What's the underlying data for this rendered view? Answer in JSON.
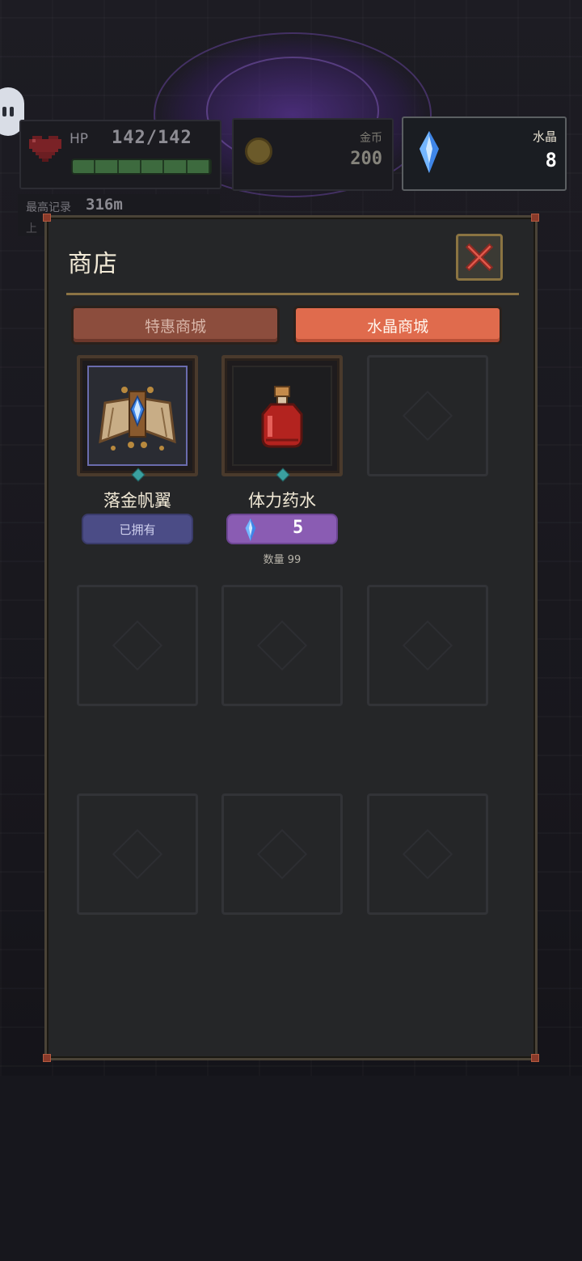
{
  "hud": {
    "hp_label": "HP",
    "hp_value": "142/142",
    "hp_fraction": 1.0,
    "gold_label": "金币",
    "gold_value": "200",
    "crystal_label": "水晶",
    "crystal_value": "8"
  },
  "record": {
    "label": "最高记录",
    "value": "316m",
    "sub": "上"
  },
  "shop": {
    "title": "商店",
    "close_icon": "close-x-icon",
    "tabs": [
      {
        "label": "特惠商城",
        "active": false
      },
      {
        "label": "水晶商城",
        "active": true
      }
    ],
    "items": [
      {
        "name": "落金帆翼",
        "icon": "golden-sail-wings-icon",
        "status": "已拥有"
      },
      {
        "name": "体力药水",
        "icon": "stamina-potion-icon",
        "price": "5",
        "price_icon": "crystal-icon",
        "quantity": "数量 99"
      }
    ]
  },
  "colors": {
    "accent_tab_active": "#e06b4d",
    "tab_inactive": "#8c4d3d",
    "owned_button": "#4b4c86",
    "price_button": "#8a5cb3",
    "crystal": "#4aa8ff"
  }
}
